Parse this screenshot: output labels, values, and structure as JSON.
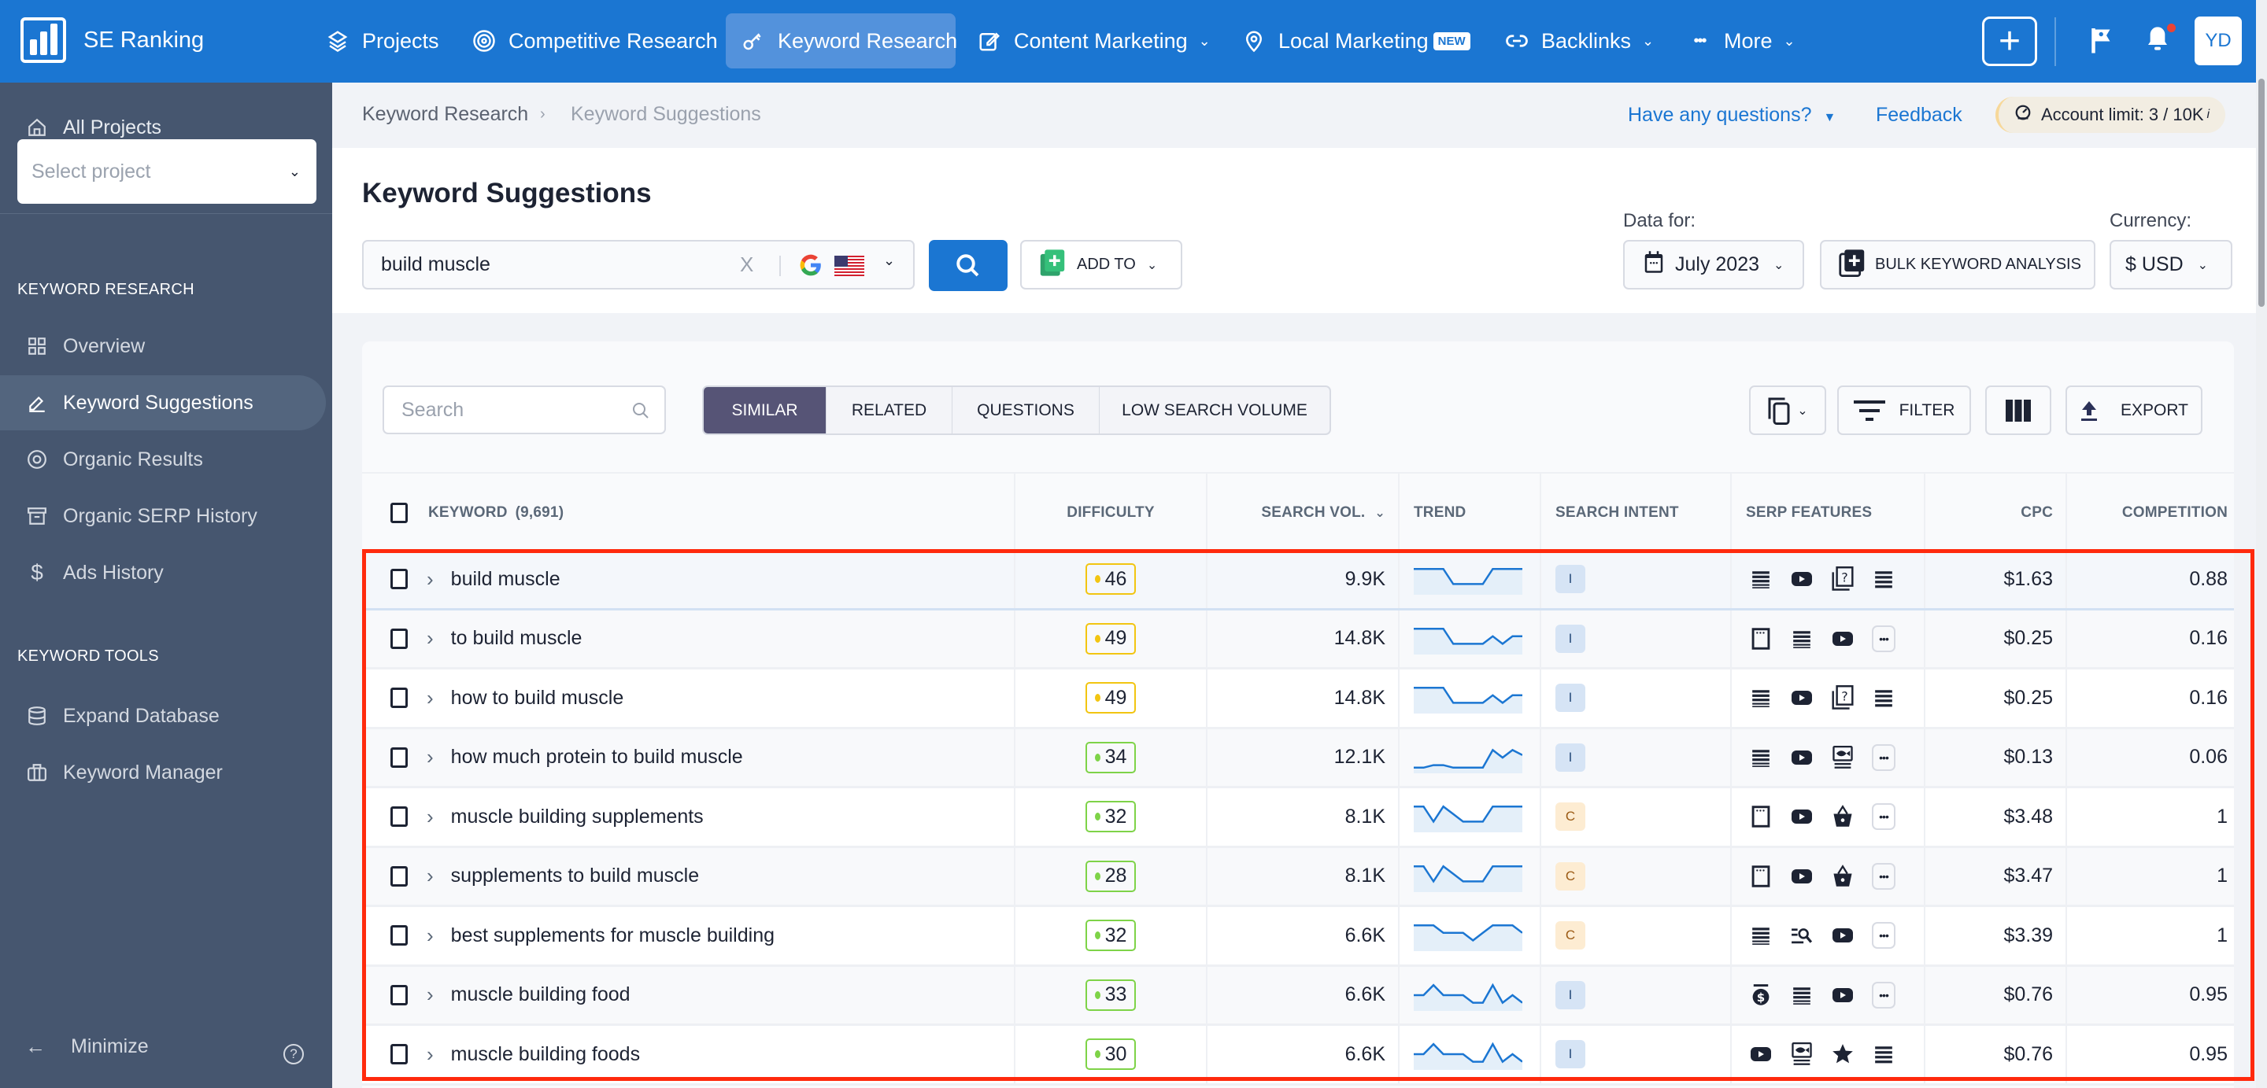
{
  "app": {
    "name": "SE Ranking",
    "avatar_initials": "YD"
  },
  "topnav": {
    "items": [
      {
        "label": "Projects",
        "icon": "layers-icon"
      },
      {
        "label": "Competitive Research",
        "icon": "target-icon"
      },
      {
        "label": "Keyword Research",
        "icon": "key-icon",
        "active": true
      },
      {
        "label": "Content Marketing",
        "icon": "edit-icon",
        "has_dropdown": true
      },
      {
        "label": "Local Marketing",
        "icon": "map-pin-icon",
        "badge": "NEW"
      },
      {
        "label": "Backlinks",
        "icon": "link-icon",
        "has_dropdown": true
      },
      {
        "label": "More",
        "icon": "more-icon",
        "has_dropdown": true
      }
    ],
    "add_label": "+"
  },
  "sidebar": {
    "all_projects": "All Projects",
    "select_project_placeholder": "Select project",
    "section1_title": "KEYWORD RESEARCH",
    "section1_items": [
      {
        "label": "Overview",
        "icon": "grid-icon"
      },
      {
        "label": "Keyword Suggestions",
        "icon": "pencil-icon",
        "active": true
      },
      {
        "label": "Organic Results",
        "icon": "eye-icon"
      },
      {
        "label": "Organic SERP History",
        "icon": "archive-icon"
      },
      {
        "label": "Ads History",
        "icon": "dollar-icon"
      }
    ],
    "section2_title": "KEYWORD TOOLS",
    "section2_items": [
      {
        "label": "Expand Database",
        "icon": "database-icon"
      },
      {
        "label": "Keyword Manager",
        "icon": "briefcase-icon"
      }
    ],
    "minimize_label": "Minimize",
    "help_label": "?"
  },
  "breadcrumb": {
    "items": [
      "Keyword Research",
      "Keyword Suggestions"
    ],
    "separator": "›"
  },
  "header_links": {
    "questions": "Have any questions?",
    "feedback": "Feedback",
    "account_limit_label": "Account limit:",
    "account_limit_value": "3 / 10K",
    "info": "i"
  },
  "page": {
    "title": "Keyword Suggestions",
    "keyword_value": "build muscle",
    "clear": "X",
    "add_to_label": "ADD TO",
    "data_for_label": "Data for:",
    "month_value": "July 2023",
    "bulk_label": "BULK KEYWORD ANALYSIS",
    "currency_label": "Currency:",
    "currency_value": "$ USD"
  },
  "toolbar": {
    "search_placeholder": "Search",
    "tabs": [
      {
        "label": "SIMILAR",
        "active": true
      },
      {
        "label": "RELATED"
      },
      {
        "label": "QUESTIONS"
      },
      {
        "label": "LOW SEARCH VOLUME"
      }
    ],
    "filter_label": "FILTER",
    "export_label": "EXPORT"
  },
  "table": {
    "columns": {
      "keyword": "KEYWORD",
      "keyword_count": "(9,691)",
      "difficulty": "DIFFICULTY",
      "search_vol": "SEARCH VOL.",
      "trend": "TREND",
      "intent": "SEARCH INTENT",
      "serp": "SERP FEATURES",
      "cpc": "CPC",
      "competition": "COMPETITION"
    },
    "colors": {
      "diff_yellow": "#f2c511",
      "diff_green": "#7ed348",
      "intent_I_bg": "#d6e4f5",
      "intent_I_fg": "#2a4e7c",
      "intent_C_bg": "#fdecd2",
      "intent_C_fg": "#9b5a14",
      "trend_line": "#1b76d2",
      "trend_fill": "#e4eff9"
    },
    "rows": [
      {
        "keyword": "build muscle",
        "difficulty": "46",
        "diff_level": "yellow",
        "volume": "9.9K",
        "trend": [
          9,
          9,
          9,
          9,
          3,
          3,
          3,
          3,
          9,
          9,
          9,
          9
        ],
        "intent": "I",
        "serp": [
          "organic-list-icon",
          "video-icon",
          "faq-icon",
          "list-icon"
        ],
        "cpc": "$1.63",
        "competition": "0.88"
      },
      {
        "keyword": "to build muscle",
        "difficulty": "49",
        "diff_level": "yellow",
        "volume": "14.8K",
        "trend": [
          9,
          9,
          9,
          9,
          3,
          3,
          3,
          3,
          6,
          3,
          6,
          6
        ],
        "intent": "I",
        "serp": [
          "snippet-icon",
          "organic-list-icon",
          "video-icon",
          "more"
        ],
        "cpc": "$0.25",
        "competition": "0.16"
      },
      {
        "keyword": "how to build muscle",
        "difficulty": "49",
        "diff_level": "yellow",
        "volume": "14.8K",
        "trend": [
          9,
          9,
          9,
          9,
          3,
          3,
          3,
          3,
          6,
          3,
          6,
          6
        ],
        "intent": "I",
        "serp": [
          "organic-list-icon",
          "video-icon",
          "faq-icon",
          "list-icon"
        ],
        "cpc": "$0.25",
        "competition": "0.16"
      },
      {
        "keyword": "how much protein to build muscle",
        "difficulty": "34",
        "diff_level": "green",
        "volume": "12.1K",
        "trend": [
          1,
          1,
          2,
          2,
          1,
          1,
          1,
          1,
          8,
          5,
          8,
          6
        ],
        "intent": "I",
        "serp": [
          "organic-list-icon",
          "video-icon",
          "image-pack-icon",
          "more"
        ],
        "cpc": "$0.13",
        "competition": "0.06"
      },
      {
        "keyword": "muscle building supplements",
        "difficulty": "32",
        "diff_level": "green",
        "volume": "8.1K",
        "trend": [
          9,
          9,
          3,
          9,
          6,
          3,
          3,
          3,
          9,
          9,
          9,
          9
        ],
        "intent": "C",
        "serp": [
          "snippet-icon",
          "video-icon",
          "shopping-icon",
          "more"
        ],
        "cpc": "$3.48",
        "competition": "1"
      },
      {
        "keyword": "supplements to build muscle",
        "difficulty": "28",
        "diff_level": "green",
        "volume": "8.1K",
        "trend": [
          9,
          9,
          3,
          9,
          6,
          3,
          3,
          3,
          9,
          9,
          9,
          9
        ],
        "intent": "C",
        "serp": [
          "snippet-icon",
          "video-icon",
          "shopping-icon",
          "more"
        ],
        "cpc": "$3.47",
        "competition": "1"
      },
      {
        "keyword": "best supplements for muscle building",
        "difficulty": "32",
        "diff_level": "green",
        "volume": "6.6K",
        "trend": [
          9,
          9,
          9,
          6,
          6,
          6,
          3,
          6,
          9,
          9,
          9,
          6
        ],
        "intent": "C",
        "serp": [
          "organic-list-icon",
          "related-search-icon",
          "video-icon",
          "more"
        ],
        "cpc": "$3.39",
        "competition": "1"
      },
      {
        "keyword": "muscle building food",
        "difficulty": "33",
        "diff_level": "green",
        "volume": "6.6K",
        "trend": [
          5,
          5,
          9,
          5,
          5,
          5,
          2,
          2,
          9,
          2,
          5,
          2
        ],
        "intent": "I",
        "serp": [
          "ads-icon",
          "organic-list-icon",
          "video-icon",
          "more"
        ],
        "cpc": "$0.76",
        "competition": "0.95"
      },
      {
        "keyword": "muscle building foods",
        "difficulty": "30",
        "diff_level": "green",
        "volume": "6.6K",
        "trend": [
          5,
          5,
          9,
          5,
          5,
          5,
          2,
          2,
          9,
          2,
          5,
          2
        ],
        "intent": "I",
        "serp": [
          "video-icon",
          "image-pack-icon",
          "reviews-star-icon",
          "list-icon"
        ],
        "cpc": "$0.76",
        "competition": "0.95"
      }
    ]
  }
}
